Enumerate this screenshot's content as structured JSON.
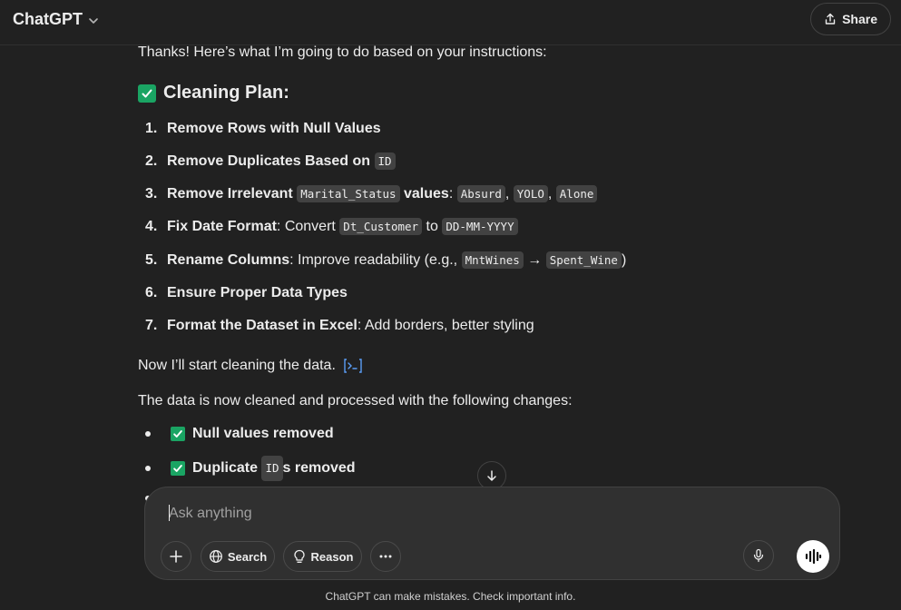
{
  "header": {
    "title": "ChatGPT",
    "share_label": "Share"
  },
  "message": {
    "intro": "Thanks! Here’s what I’m going to do based on your instructions:",
    "plan_title": "Cleaning Plan:",
    "plan_items": [
      {
        "num": "1.",
        "bold": "Remove Rows with Null Values"
      },
      {
        "num": "2.",
        "bold": "Remove Duplicates Based on",
        "code1": "ID"
      },
      {
        "num": "3.",
        "bold": "Remove Irrelevant",
        "code1": "Marital_Status",
        "bold2": "values",
        "colon": ":",
        "code2": "Absurd",
        "code3": "YOLO",
        "code4": "Alone"
      },
      {
        "num": "4.",
        "bold": "Fix Date Format",
        "text": ": Convert",
        "code1": "Dt_Customer",
        "text2": "to",
        "code2": "DD-MM-YYYY"
      },
      {
        "num": "5.",
        "bold": "Rename Columns",
        "text": ": Improve readability (e.g.,",
        "code1": "MntWines",
        "arrow": "→",
        "code2": "Spent_Wine",
        "close": ")"
      },
      {
        "num": "6.",
        "bold": "Ensure Proper Data Types"
      },
      {
        "num": "7.",
        "bold": "Format the Dataset in Excel",
        "text": ": Add borders, better styling"
      }
    ],
    "start_text": "Now I’ll start cleaning the data.",
    "done_text": "The data is now cleaned and processed with the following changes:",
    "bullets": [
      {
        "bold": "Null values removed"
      },
      {
        "bold": "Duplicate",
        "code": "ID",
        "bold2": "s removed"
      }
    ]
  },
  "composer": {
    "placeholder": "Ask anything",
    "search_label": "Search",
    "reason_label": "Reason"
  },
  "footer": {
    "disclaimer": "ChatGPT can make mistakes. Check important info."
  },
  "colors": {
    "background": "#212121",
    "check_green": "#1aa463",
    "code_bg": "#424242",
    "composer_bg": "#303030"
  }
}
